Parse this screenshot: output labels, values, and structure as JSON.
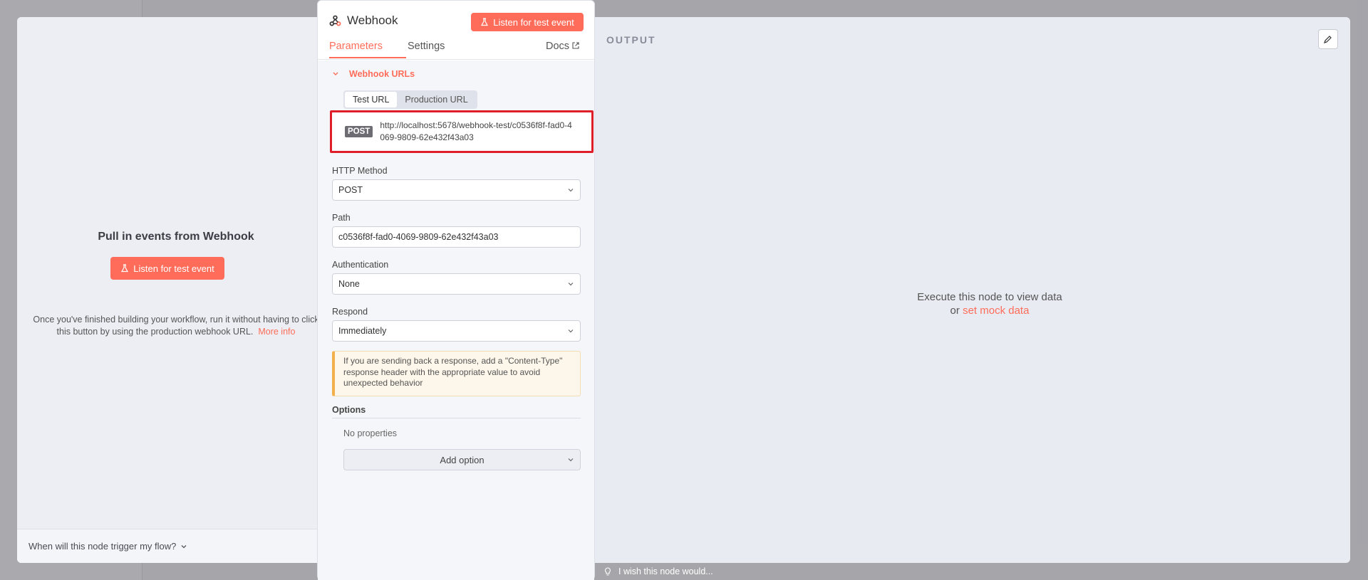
{
  "node": {
    "title": "Webhook",
    "listen_button": "Listen for test event",
    "tabs": {
      "parameters": "Parameters",
      "settings": "Settings",
      "docs": "Docs"
    }
  },
  "webhook_urls": {
    "section_title": "Webhook URLs",
    "tabs": {
      "test": "Test URL",
      "production": "Production URL"
    },
    "method_badge": "POST",
    "url": "http://localhost:5678/webhook-test/c0536f8f-fad0-4069-9809-62e432f43a03"
  },
  "fields": {
    "http_method": {
      "label": "HTTP Method",
      "value": "POST"
    },
    "path": {
      "label": "Path",
      "value": "c0536f8f-fad0-4069-9809-62e432f43a03"
    },
    "authentication": {
      "label": "Authentication",
      "value": "None"
    },
    "respond": {
      "label": "Respond",
      "value": "Immediately"
    }
  },
  "notice": "If you are sending back a response, add a \"Content-Type\" response header with the appropriate value to avoid unexpected behavior",
  "options": {
    "label": "Options",
    "empty": "No properties",
    "add_button": "Add option"
  },
  "input_panel": {
    "title": "Pull in events from Webhook",
    "listen_button": "Listen for test event",
    "hint": "Once you've finished building your workflow, run it without having to click this button by using the production webhook URL.",
    "hint_link": "More info",
    "trigger_question": "When will this node trigger my flow?"
  },
  "output_panel": {
    "label": "OUTPUT",
    "message": "Execute this node to view data",
    "or": "or",
    "mock_link": "set mock data"
  },
  "feedback": "I wish this node would...",
  "colors": {
    "accent": "#ff6d5a",
    "highlight": "#e01e2a",
    "warning": "#f2b04b"
  }
}
